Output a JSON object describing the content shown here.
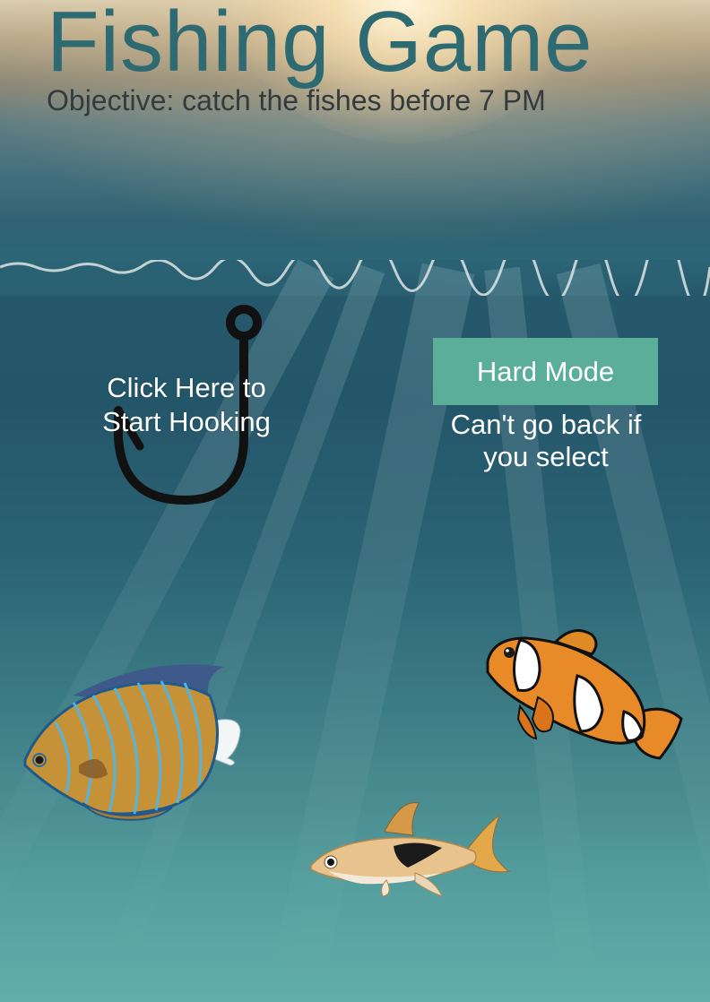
{
  "game": {
    "title": "Fishing Game",
    "objective": "Objective: catch the fishes before 7 PM"
  },
  "start": {
    "label_line1": "Click Here to",
    "label_line2": "Start Hooking"
  },
  "hard_mode": {
    "button_label": "Hard Mode",
    "note_line1": "Can't go back if",
    "note_line2": "you select"
  },
  "colors": {
    "title": "#2e6a72",
    "objective": "#333b3c",
    "hard_mode_button": "#5bae98",
    "hook": "#111111"
  },
  "fish": [
    {
      "name": "blue-ring-angelfish",
      "icon": "angelfish-icon"
    },
    {
      "name": "clownfish",
      "icon": "clownfish-icon"
    },
    {
      "name": "harlequin-rasbora",
      "icon": "rasbora-icon"
    }
  ]
}
